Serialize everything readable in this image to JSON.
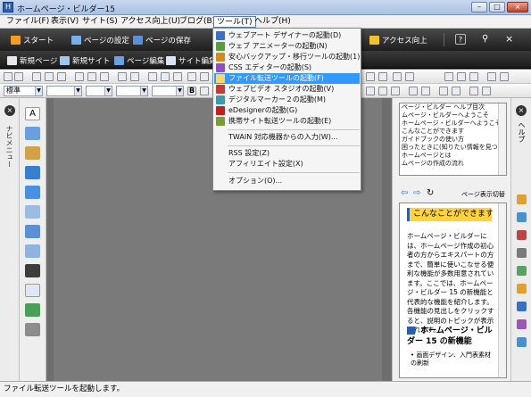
{
  "window": {
    "title": "ホームページ・ビルダー15",
    "minimize_glyph": "–",
    "maximize_glyph": "□",
    "close_glyph": "×"
  },
  "menubar": [
    {
      "label": "ファイル(F)"
    },
    {
      "label": "表示(V)"
    },
    {
      "label": "サイト(S)"
    },
    {
      "label": "アクセス向上(U)"
    },
    {
      "label": "ブログ(B)"
    },
    {
      "label": "ツール(T)"
    },
    {
      "label": "ヘルプ(H)"
    }
  ],
  "ribbon": {
    "row1": [
      {
        "label": "スタート",
        "icon": "start-icon"
      },
      {
        "label": "ページの設定",
        "icon": "page-settings-icon"
      },
      {
        "label": "ページの保存",
        "icon": "save-icon"
      },
      {
        "label": "アクセス向上",
        "icon": "access-up-icon"
      }
    ],
    "row2": [
      {
        "label": "新規ページ",
        "icon": "new-page-icon"
      },
      {
        "label": "新規サイト",
        "icon": "new-site-icon"
      },
      {
        "label": "ページ編集",
        "icon": "page-edit-icon"
      },
      {
        "label": "サイト編集",
        "icon": "site-edit-icon"
      }
    ]
  },
  "toolbar": {
    "style_combo": "標準"
  },
  "tools_menu": {
    "items": [
      {
        "label": "ウェブアート デザイナーの起動(D)",
        "icon": "webart-icon",
        "color": "#3a6fc4"
      },
      {
        "label": "ウェブ アニメーターの起動(N)",
        "icon": "animator-icon",
        "color": "#5a9b3a"
      },
      {
        "label": "安心バックアップ・移行ツールの起動(1)",
        "icon": "backup-icon",
        "color": "#d48a1f"
      },
      {
        "label": "CSS エディターの起動(S)",
        "icon": "css-editor-icon",
        "color": "#8a4fc4"
      },
      {
        "label": "ファイル転送ツールの起動(F)",
        "icon": "file-transfer-icon",
        "color": "#2a80c8",
        "highlighted": true
      },
      {
        "label": "ウェブビデオ スタジオの起動(V)",
        "icon": "video-studio-icon",
        "color": "#c43a3a"
      },
      {
        "label": "デジタルマーカー２の起動(M)",
        "icon": "marker-icon",
        "color": "#3a9bb0"
      },
      {
        "label": "eDesignerの起動(G)",
        "icon": "edesigner-icon",
        "color": "#c21f1f"
      },
      {
        "label": "携帯サイト転送ツールの起動(E)",
        "icon": "mobile-transfer-icon",
        "color": "#7a9b3a"
      },
      {
        "separator": true
      },
      {
        "label": "TWAIN 対応機器からの入力(W)..."
      },
      {
        "separator": true
      },
      {
        "label": "RSS 設定(Z)"
      },
      {
        "label": "アフィリエイト設定(X)"
      },
      {
        "separator": true
      },
      {
        "label": "オプション(O)..."
      }
    ]
  },
  "left_panel": {
    "tab_label": "ナビメニュー"
  },
  "right_panel": {
    "outline": [
      "ページ・ビルダー ヘルプ目次",
      "ムページ・ビルダーへようこそ",
      "ホームページ・ビルダーへようこそ",
      "こんなことができます",
      "ガイドブックの使い方",
      "困ったときに(知りたい情報を見つけ",
      "ホームページとは",
      "ムページの作成の流れ"
    ],
    "nav_label": "ページ表示切替",
    "help": {
      "banner": "こんなことができます",
      "body": "ホームページ・ビルダーには、ホームページ作成の初心者の方からエキスパートの方まで、簡単に使いこなせる便利な機能が多数用意されています。ここでは、ホームページ・ビルダー 15 の新機能と代表的な機能を紹介します。各機能の見出しをクリックすると、説明のトピックが表示されます。",
      "heading": "ホームページ・ビルダー 15 の新機能",
      "list": [
        "画面デザイン、入門表素材の刷新"
      ]
    }
  },
  "right_strip": {
    "tab_label": "ヘルプ"
  },
  "statusbar": {
    "text": "ファイル転送ツールを起動します。"
  }
}
